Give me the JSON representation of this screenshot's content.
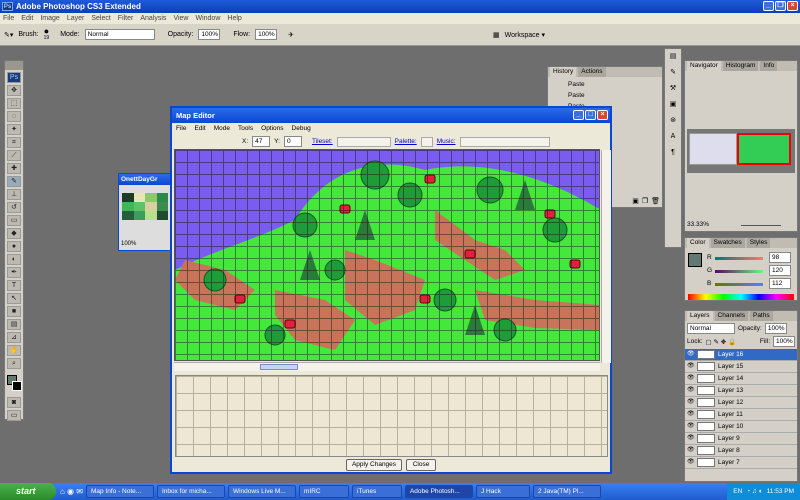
{
  "photoshop": {
    "title": "Adobe Photoshop CS3 Extended",
    "menu": [
      "File",
      "Edit",
      "Image",
      "Layer",
      "Select",
      "Filter",
      "Analysis",
      "View",
      "Window",
      "Help"
    ],
    "options": {
      "brush_label": "Brush:",
      "brush_size": "19",
      "mode_label": "Mode:",
      "mode_value": "Normal",
      "opacity_label": "Opacity:",
      "opacity_value": "100%",
      "flow_label": "Flow:",
      "flow_value": "100%",
      "workspace_label": "Workspace ▾"
    }
  },
  "small_doc": {
    "title": "OnettDayGr",
    "zoom": "100%"
  },
  "history": {
    "tabs": [
      "History",
      "Actions"
    ],
    "items": [
      "Paste",
      "Paste",
      "Paste"
    ]
  },
  "navigator": {
    "tabs": [
      "Navigator",
      "Histogram",
      "Info"
    ],
    "zoom": "33.33%"
  },
  "color": {
    "tabs": [
      "Color",
      "Swatches",
      "Styles"
    ],
    "r": "98",
    "g": "120",
    "b": "112",
    "fg_color": "#627870"
  },
  "layers": {
    "tabs": [
      "Layers",
      "Channels",
      "Paths"
    ],
    "blend": "Normal",
    "opacity_label": "Opacity:",
    "opacity": "100%",
    "lock_label": "Lock:",
    "fill_label": "Fill:",
    "fill": "100%",
    "items": [
      "Layer 16",
      "Layer 15",
      "Layer 14",
      "Layer 13",
      "Layer 12",
      "Layer 11",
      "Layer 10",
      "Layer 9",
      "Layer 8",
      "Layer 7"
    ]
  },
  "map_editor": {
    "title": "Map Editor",
    "menu": [
      "File",
      "Edit",
      "Mode",
      "Tools",
      "Options",
      "Debug"
    ],
    "x_label": "X:",
    "x_value": "47",
    "y_label": "Y:",
    "y_value": "0",
    "tileset_label": "Tileset:",
    "palette_label": "Palette:",
    "music_label": "Music:",
    "apply_label": "Apply Changes",
    "close_label": "Close"
  },
  "taskbar": {
    "start": "start",
    "tasks": [
      "Map Info - Note...",
      "Inbox for micha...",
      "Windows Live M...",
      "mIRC",
      "iTunes",
      "Adobe Photosh...",
      "J Hack",
      "2 Java(TM) Pl..."
    ],
    "lang": "EN",
    "time": "11:53 PM"
  }
}
